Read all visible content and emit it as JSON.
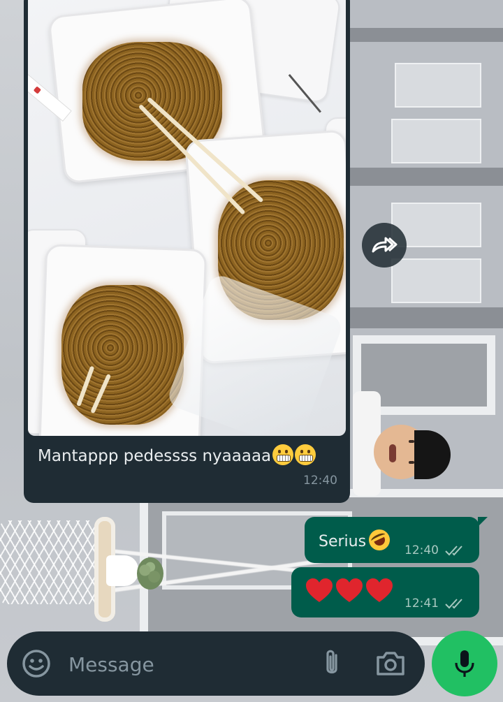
{
  "chat": {
    "incoming": {
      "caption": "Mantappp pedessss nyaaaaa",
      "caption_emoji": [
        "grimacing-face-emoji",
        "grimacing-face-emoji"
      ],
      "time": "12:40"
    },
    "outgoing": [
      {
        "text": "Serius",
        "emoji": "rolling-on-floor-laughing-emoji",
        "time": "12:40",
        "status": "read"
      },
      {
        "text": "",
        "emoji": "red-heart-emoji x3",
        "time": "12:41",
        "status": "read"
      }
    ]
  },
  "composer": {
    "placeholder": "Message"
  },
  "icons": {
    "forward": "forward-icon",
    "emoji": "emoji-icon",
    "attach": "paperclip-icon",
    "camera": "camera-icon",
    "mic": "mic-icon",
    "read_receipt": "double-check-icon"
  },
  "colors": {
    "incoming_bubble": "#1f2c34",
    "outgoing_bubble": "#005c4b",
    "mic_button": "#21c063",
    "timestamp": "#8696a0"
  }
}
